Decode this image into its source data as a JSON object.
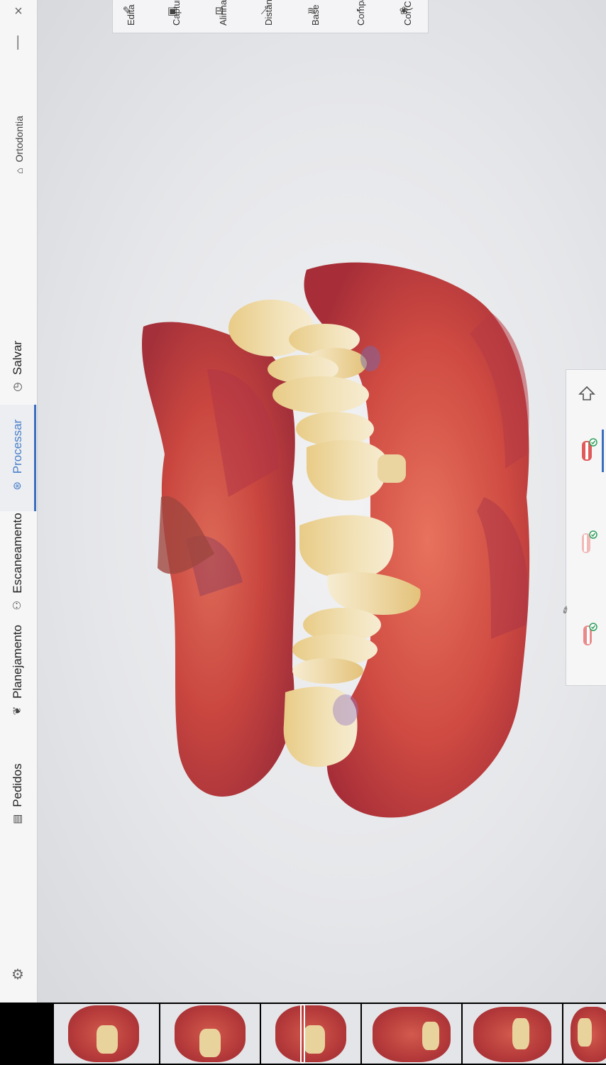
{
  "sidebar": {
    "close_label": "×",
    "minimize_label": "—",
    "brand": {
      "icon": "tooth-icon",
      "label": "Ortodontia"
    },
    "items": [
      {
        "id": "salvar",
        "label": "Salvar",
        "icon": "clock-icon"
      },
      {
        "id": "processar",
        "label": "Processar",
        "icon": "process-icon",
        "active": true
      },
      {
        "id": "escaneamento",
        "label": "Escaneamento",
        "icon": "scan-tooth-icon"
      },
      {
        "id": "planejamento",
        "label": "Planejamento",
        "icon": "plan-icon"
      },
      {
        "id": "pedidos",
        "label": "Pedidos",
        "icon": "orders-icon"
      }
    ],
    "settings_icon": "gear-icon"
  },
  "toolbar": {
    "tools": [
      {
        "label": "Edita",
        "icon": "edit-icon"
      },
      {
        "label": "Captur",
        "icon": "capture-icon"
      },
      {
        "label": "Alinha",
        "icon": "align-icon"
      },
      {
        "label": "Distânc",
        "icon": "ruler-icon"
      },
      {
        "label": "Base",
        "icon": "layers-icon"
      },
      {
        "label": "Compa",
        "icon": "compare-icon"
      },
      {
        "label": "Cor(C",
        "icon": "color-icon"
      }
    ]
  },
  "model_panel": {
    "items": [
      {
        "name": "bite-icon",
        "status": "ok"
      },
      {
        "name": "upper-jaw-icon",
        "status": "ok"
      },
      {
        "name": "lower-jaw-icon",
        "status": "ok"
      }
    ]
  },
  "colors": {
    "accent": "#3a6fc0",
    "gum": "#c9463f",
    "tooth": "#ecd9a8",
    "check": "#2e9e5b"
  }
}
